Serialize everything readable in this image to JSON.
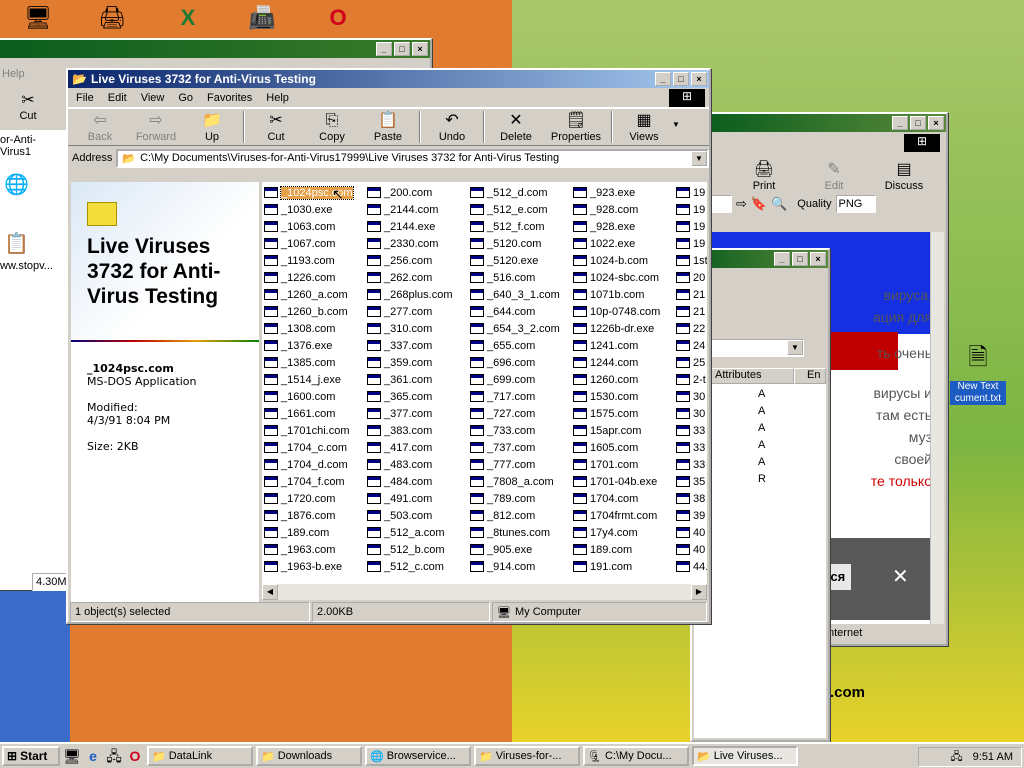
{
  "desktop": {
    "top_icons": [
      "computer-icon",
      "printer-icon",
      "excel-icon",
      "scanner-icon",
      "opera-icon"
    ],
    "left_labels": {
      "help": "Help",
      "cut": "Cut",
      "fragment1": "or-Anti-Virus1",
      "fragment2": "ww.stopv...",
      "size": "4.30M"
    },
    "new_text_doc": {
      "line1": "New Text",
      "line2": "cument.txt"
    }
  },
  "back_window": {
    "toolbar": [
      "Print",
      "Edit",
      "Discuss"
    ],
    "quality_label": "Quality",
    "quality_value": "PNG",
    "ru_text": [
      "вируса,",
      "ация для",
      "ть очень",
      "вирусы и",
      "там есть",
      "муз",
      "своей",
      "те только"
    ],
    "popup_label": "ться",
    "url_fragment": ".com",
    "internet_label": "nternet"
  },
  "mid_window": {
    "col_attributes": "Attributes",
    "col_en": "En",
    "attrs": [
      "A",
      "A",
      "A",
      "A",
      "A",
      "R"
    ]
  },
  "explorer": {
    "title": "Live Viruses 3732 for Anti-Virus Testing",
    "menu": [
      "File",
      "Edit",
      "View",
      "Go",
      "Favorites",
      "Help"
    ],
    "toolbar": {
      "back": "Back",
      "forward": "Forward",
      "up": "Up",
      "cut": "Cut",
      "copy": "Copy",
      "paste": "Paste",
      "undo": "Undo",
      "delete": "Delete",
      "properties": "Properties",
      "views": "Views"
    },
    "address_label": "Address",
    "address_value": "C:\\My Documents\\Viruses-for-Anti-Virus17999\\Live Viruses 3732 for Anti-Virus Testing",
    "webview": {
      "heading": "Live Viruses 3732 for Anti-Virus Testing",
      "selected_name": "_1024psc.com",
      "selected_type": "MS-DOS Application",
      "modified_label": "Modified:",
      "modified_value": "4/3/91 8:04 PM",
      "size_text": "Size: 2KB"
    },
    "files": [
      [
        "_1024psc.com",
        "_1030.exe",
        "_1063.com",
        "_1067.com",
        "_1193.com",
        "_1226.com",
        "_1260_a.com",
        "_1260_b.com",
        "_1308.com",
        "_1376.exe",
        "_1385.com",
        "_1514_j.exe",
        "_1600.com",
        "_1661.com",
        "_1701chi.com",
        "_1704_c.com",
        "_1704_d.com",
        "_1704_f.com",
        "_1720.com",
        "_1876.com",
        "_189.com",
        "_1963.com",
        "_1963-b.exe"
      ],
      [
        "_200.com",
        "_2144.com",
        "_2144.exe",
        "_2330.com",
        "_256.com",
        "_262.com",
        "_268plus.com",
        "_277.com",
        "_310.com",
        "_337.com",
        "_359.com",
        "_361.com",
        "_365.com",
        "_377.com",
        "_383.com",
        "_417.com",
        "_483.com",
        "_484.com",
        "_491.com",
        "_503.com",
        "_512_a.com",
        "_512_b.com",
        "_512_c.com"
      ],
      [
        "_512_d.com",
        "_512_e.com",
        "_512_f.com",
        "_5120.com",
        "_5120.exe",
        "_516.com",
        "_640_3_1.com",
        "_644.com",
        "_654_3_2.com",
        "_655.com",
        "_696.com",
        "_699.com",
        "_717.com",
        "_727.com",
        "_733.com",
        "_737.com",
        "_777.com",
        "_7808_a.com",
        "_789.com",
        "_812.com",
        "_8tunes.com",
        "_905.exe",
        "_914.com"
      ],
      [
        "_923.exe",
        "_928.com",
        "_928.exe",
        "1022.exe",
        "1024-b.com",
        "1024-sbc.com",
        "1071b.com",
        "10p-0748.com",
        "1226b-dr.exe",
        "1241.com",
        "1244.com",
        "1260.com",
        "1530.com",
        "1575.com",
        "15apr.com",
        "1605.com",
        "1701.com",
        "1701-04b.exe",
        "1704.com",
        "1704frmt.com",
        "17y4.com",
        "189.com",
        "191.com"
      ],
      [
        "19",
        "19",
        "19",
        "19",
        "1st",
        "20",
        "21",
        "21",
        "22",
        "24",
        "25",
        "2-t",
        "30",
        "30",
        "33",
        "33",
        "33",
        "35",
        "38",
        "39",
        "40",
        "40",
        "44."
      ]
    ],
    "status": {
      "selected": "1 object(s) selected",
      "size": "2.00KB",
      "zone": "My Computer"
    }
  },
  "taskbar": {
    "start": "Start",
    "tasks": [
      "DataLink",
      "Downloads",
      "Browservice...",
      "Viruses-for-...",
      "C:\\My Docu...",
      "Live Viruses..."
    ],
    "clock": "9:51 AM"
  }
}
